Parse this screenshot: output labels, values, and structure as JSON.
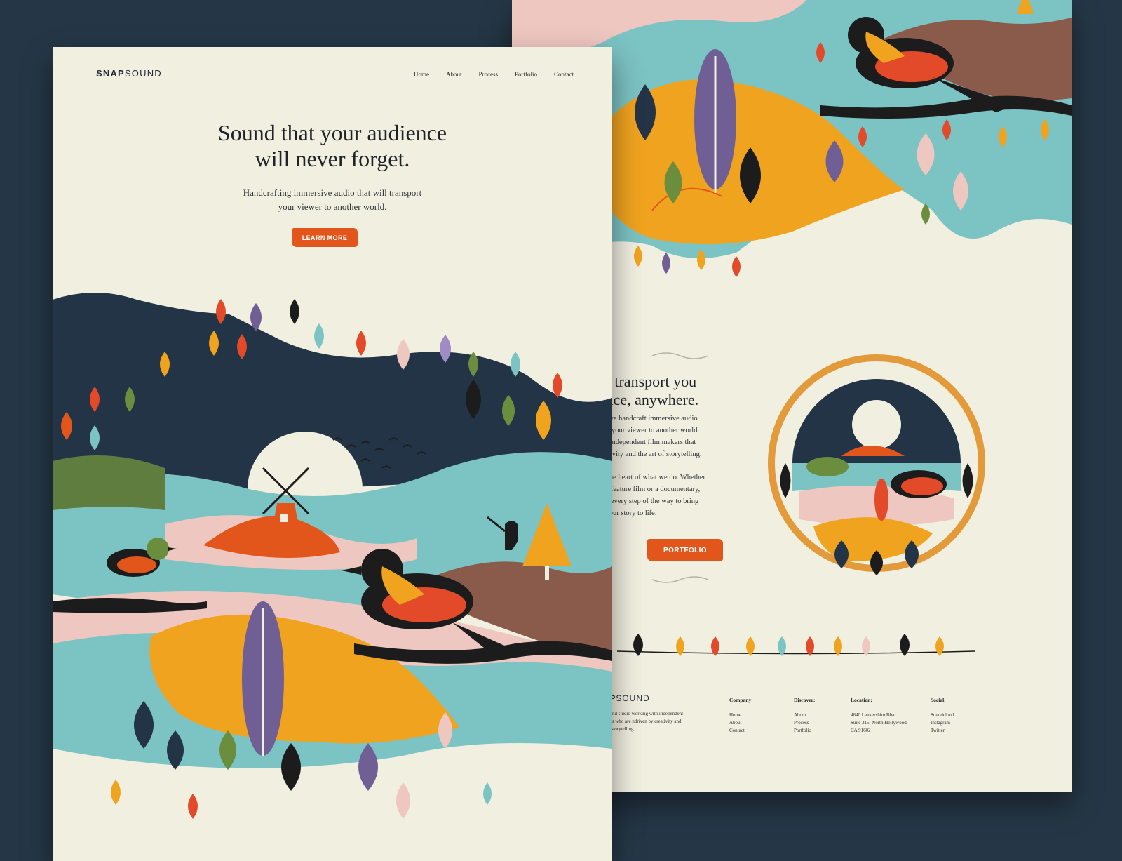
{
  "front": {
    "logo": {
      "bold": "SNAP",
      "light": "SOUND"
    },
    "nav": [
      "Home",
      "About",
      "Process",
      "Portfolio",
      "Contact"
    ],
    "hero": {
      "title_line1": "Sound that your audience",
      "title_line2": "will never forget.",
      "subtitle_line1": "Handcrafting immersive audio that will transport",
      "subtitle_line2": "your viewer to another world.",
      "cta": "LEARN MORE"
    }
  },
  "back": {
    "section_title_line1": "et sound transport you",
    "section_title_line2": "o any place, anywhere.",
    "paragraph1": [
      "At Snapsound we handcraft immersive audio",
      "at will transport your viewer to another world.",
      "We work with independent film makers that",
      "e driven by creativity and the art of storytelling."
    ],
    "paragraph2": [
      "Storytelling is at the heart of what we do. Whether",
      "our producing a feature film or a documentary,",
      "e'll be with you every step of the way to bring",
      "your story to life."
    ],
    "cta": "PORTFOLIO",
    "footer": {
      "logo_bold": "NAP",
      "logo_light": "SOUND",
      "description": [
        "'re a sound studio working with independent",
        "n makers who are ndriven by creativity and",
        "e art of storytelling."
      ],
      "columns": [
        {
          "heading": "Company:",
          "items": [
            "Home",
            "About",
            "Contact"
          ]
        },
        {
          "heading": "Discover:",
          "items": [
            "About",
            "Process",
            "Portfolio"
          ]
        },
        {
          "heading": "Location:",
          "items": [
            "4640 Lankershim Blvd.",
            "Suite 315, North Hollywood,",
            "CA 91602"
          ]
        },
        {
          "heading": "Social:",
          "items": [
            "Soundcloud",
            "Instagram",
            "Twitter"
          ]
        }
      ]
    }
  },
  "colors": {
    "background": "#253746",
    "paper": "#f1efe0",
    "accent": "#e2561c",
    "navy": "#243447",
    "teal": "#7cc3c4",
    "mustard": "#f0a31f",
    "pink": "#efc7c1",
    "purple": "#6f5f94",
    "olive": "#6b8e3e"
  }
}
